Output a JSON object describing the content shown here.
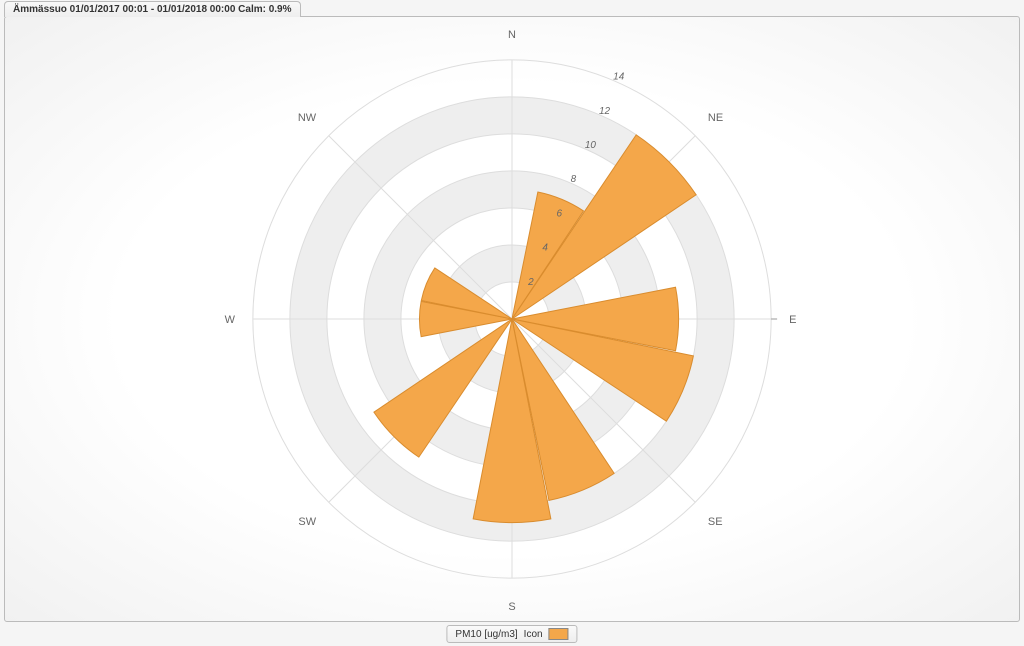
{
  "title": "Ämmässuo 01/01/2017 00:01 - 01/01/2018 00:00 Calm: 0.9%",
  "legend": {
    "series_label": "PM10 [ug/m3]",
    "icon_label": "Icon",
    "swatch_color": "#f4a74a"
  },
  "chart_data": {
    "type": "polar-bar",
    "title": "",
    "directions": [
      "N",
      "NNE",
      "NE",
      "ENE",
      "E",
      "ESE",
      "SE",
      "SSE",
      "S",
      "SSW",
      "SW",
      "WSW",
      "W",
      "WNW",
      "NW",
      "NNW"
    ],
    "values": [
      0,
      7,
      12,
      0,
      9,
      10,
      0,
      10,
      11,
      0,
      9,
      0,
      5,
      5,
      0,
      0
    ],
    "unit": "µg/m3",
    "ticks": [
      2,
      4,
      6,
      8,
      10,
      12,
      14
    ],
    "rmax": 14,
    "sector_half_width_deg": 11,
    "colors": {
      "fill": "#f4a74a",
      "stroke": "#d98c2e"
    },
    "grid": {
      "alt_bg": "#eeeeee",
      "rings": 7
    }
  },
  "compass_labels": {
    "N": "N",
    "NE": "NE",
    "E": "E",
    "SE": "SE",
    "S": "S",
    "SW": "SW",
    "W": "W",
    "NW": "NW"
  }
}
